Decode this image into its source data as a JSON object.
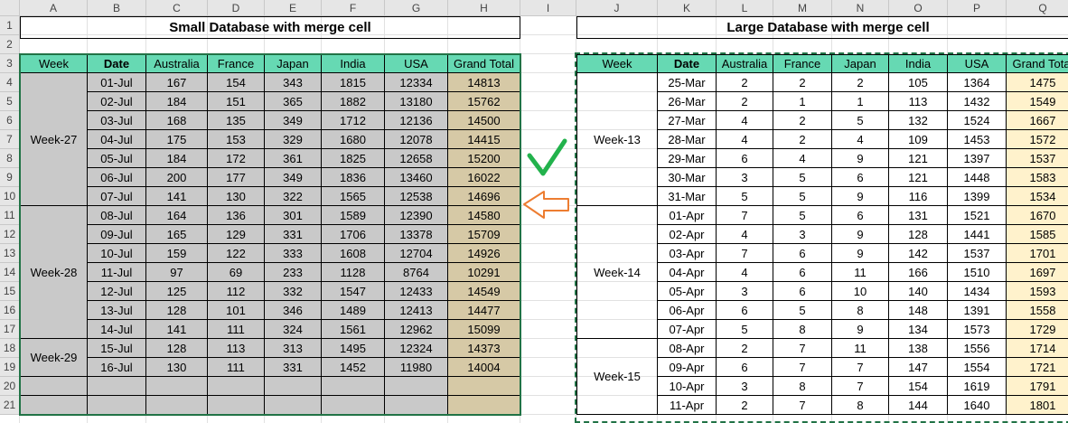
{
  "columns": [
    "A",
    "B",
    "C",
    "D",
    "E",
    "F",
    "G",
    "H",
    "I",
    "J",
    "K",
    "L",
    "M",
    "N",
    "O",
    "P",
    "Q"
  ],
  "rows": [
    "1",
    "2",
    "3",
    "4",
    "5",
    "6",
    "7",
    "8",
    "9",
    "10",
    "11",
    "12",
    "13",
    "14",
    "15",
    "16",
    "17",
    "18",
    "19",
    "20",
    "21"
  ],
  "left": {
    "title": "Small Database with merge cell",
    "headers": [
      "Week",
      "Date",
      "Australia",
      "France",
      "Japan",
      "India",
      "USA",
      "Grand Total"
    ],
    "weeks": [
      {
        "label": "Week-27",
        "rows": [
          [
            "01-Jul",
            "167",
            "154",
            "343",
            "1815",
            "12334",
            "14813"
          ],
          [
            "02-Jul",
            "184",
            "151",
            "365",
            "1882",
            "13180",
            "15762"
          ],
          [
            "03-Jul",
            "168",
            "135",
            "349",
            "1712",
            "12136",
            "14500"
          ],
          [
            "04-Jul",
            "175",
            "153",
            "329",
            "1680",
            "12078",
            "14415"
          ],
          [
            "05-Jul",
            "184",
            "172",
            "361",
            "1825",
            "12658",
            "15200"
          ],
          [
            "06-Jul",
            "200",
            "177",
            "349",
            "1836",
            "13460",
            "16022"
          ],
          [
            "07-Jul",
            "141",
            "130",
            "322",
            "1565",
            "12538",
            "14696"
          ]
        ]
      },
      {
        "label": "Week-28",
        "rows": [
          [
            "08-Jul",
            "164",
            "136",
            "301",
            "1589",
            "12390",
            "14580"
          ],
          [
            "09-Jul",
            "165",
            "129",
            "331",
            "1706",
            "13378",
            "15709"
          ],
          [
            "10-Jul",
            "159",
            "122",
            "333",
            "1608",
            "12704",
            "14926"
          ],
          [
            "11-Jul",
            "97",
            "69",
            "233",
            "1128",
            "8764",
            "10291"
          ],
          [
            "12-Jul",
            "125",
            "112",
            "332",
            "1547",
            "12433",
            "14549"
          ],
          [
            "13-Jul",
            "128",
            "101",
            "346",
            "1489",
            "12413",
            "14477"
          ],
          [
            "14-Jul",
            "141",
            "111",
            "324",
            "1561",
            "12962",
            "15099"
          ]
        ]
      },
      {
        "label": "Week-29",
        "rows": [
          [
            "15-Jul",
            "128",
            "113",
            "313",
            "1495",
            "12324",
            "14373"
          ],
          [
            "16-Jul",
            "130",
            "111",
            "331",
            "1452",
            "11980",
            "14004"
          ]
        ]
      }
    ]
  },
  "right": {
    "title": "Large Database with merge cell",
    "headers": [
      "Week",
      "Date",
      "Australia",
      "France",
      "Japan",
      "India",
      "USA",
      "Grand Total"
    ],
    "weeks": [
      {
        "label": "Week-13",
        "rows": [
          [
            "25-Mar",
            "2",
            "2",
            "2",
            "105",
            "1364",
            "1475"
          ],
          [
            "26-Mar",
            "2",
            "1",
            "1",
            "113",
            "1432",
            "1549"
          ],
          [
            "27-Mar",
            "4",
            "2",
            "5",
            "132",
            "1524",
            "1667"
          ],
          [
            "28-Mar",
            "4",
            "2",
            "4",
            "109",
            "1453",
            "1572"
          ],
          [
            "29-Mar",
            "6",
            "4",
            "9",
            "121",
            "1397",
            "1537"
          ],
          [
            "30-Mar",
            "3",
            "5",
            "6",
            "121",
            "1448",
            "1583"
          ],
          [
            "31-Mar",
            "5",
            "5",
            "9",
            "116",
            "1399",
            "1534"
          ]
        ]
      },
      {
        "label": "Week-14",
        "rows": [
          [
            "01-Apr",
            "7",
            "5",
            "6",
            "131",
            "1521",
            "1670"
          ],
          [
            "02-Apr",
            "4",
            "3",
            "9",
            "128",
            "1441",
            "1585"
          ],
          [
            "03-Apr",
            "7",
            "6",
            "9",
            "142",
            "1537",
            "1701"
          ],
          [
            "04-Apr",
            "4",
            "6",
            "11",
            "166",
            "1510",
            "1697"
          ],
          [
            "05-Apr",
            "3",
            "6",
            "10",
            "140",
            "1434",
            "1593"
          ],
          [
            "06-Apr",
            "6",
            "5",
            "8",
            "148",
            "1391",
            "1558"
          ],
          [
            "07-Apr",
            "5",
            "8",
            "9",
            "134",
            "1573",
            "1729"
          ]
        ]
      },
      {
        "label": "Week-15",
        "rows": [
          [
            "08-Apr",
            "2",
            "7",
            "11",
            "138",
            "1556",
            "1714"
          ],
          [
            "09-Apr",
            "6",
            "7",
            "7",
            "147",
            "1554",
            "1721"
          ],
          [
            "10-Apr",
            "3",
            "8",
            "7",
            "154",
            "1619",
            "1791"
          ],
          [
            "11-Apr",
            "2",
            "7",
            "8",
            "144",
            "1640",
            "1801"
          ]
        ]
      }
    ]
  },
  "icons": {
    "check": "check-mark-icon",
    "arrow": "left-arrow-icon"
  },
  "colors": {
    "header": "#66d9b3",
    "weekFill": "#c9c9c9",
    "totalFill": "#d6c9a6",
    "totalFillRight": "#fff2cc",
    "selection": "#217346",
    "check": "#22b24c",
    "arrow": "#ed7d31"
  }
}
